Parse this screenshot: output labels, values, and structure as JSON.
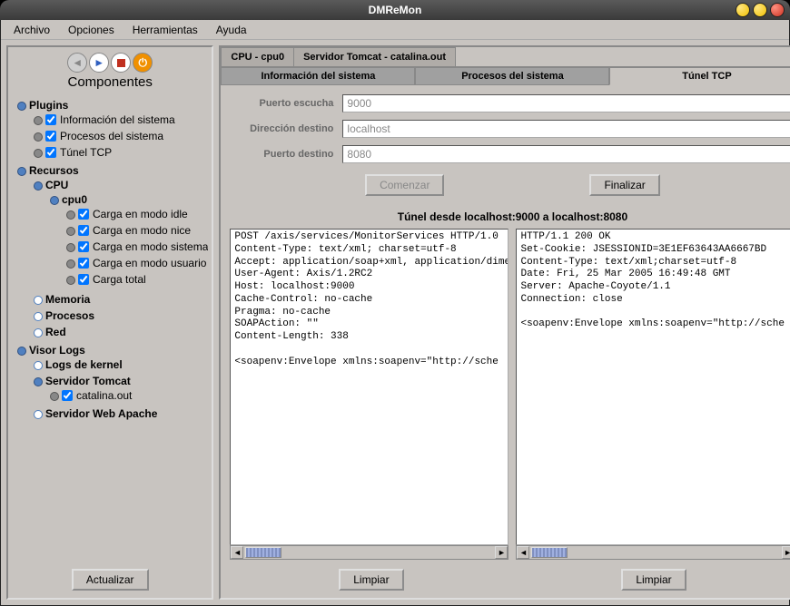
{
  "window": {
    "title": "DMReMon"
  },
  "menu": {
    "items": [
      "Archivo",
      "Opciones",
      "Herramientas",
      "Ayuda"
    ]
  },
  "sidebar": {
    "title": "Componentes",
    "update_btn": "Actualizar",
    "plugins": {
      "label": "Plugins",
      "items": [
        "Información del sistema",
        "Procesos del sistema",
        "Túnel TCP"
      ]
    },
    "recursos": {
      "label": "Recursos",
      "cpu": {
        "label": "CPU",
        "cpu0": {
          "label": "cpu0",
          "items": [
            "Carga en modo idle",
            "Carga en modo nice",
            "Carga en modo sistema",
            "Carga en modo usuario",
            "Carga total"
          ]
        }
      },
      "memoria": "Memoria",
      "procesos": "Procesos",
      "red": "Red"
    },
    "visorlogs": {
      "label": "Visor Logs",
      "kernel": "Logs de kernel",
      "tomcat": {
        "label": "Servidor Tomcat",
        "items": [
          "catalina.out"
        ]
      },
      "apache": "Servidor Web Apache"
    }
  },
  "tabs": {
    "top": [
      "CPU - cpu0",
      "Servidor Tomcat - catalina.out"
    ],
    "sub": [
      "Información del sistema",
      "Procesos del sistema",
      "Túnel TCP"
    ]
  },
  "form": {
    "listen_label": "Puerto escucha",
    "listen_value": "9000",
    "host_label": "Dirección destino",
    "host_value": "localhost",
    "destport_label": "Puerto destino",
    "destport_value": "8080",
    "start_btn": "Comenzar",
    "stop_btn": "Finalizar"
  },
  "tunnel": {
    "title": "Túnel desde localhost:9000 a localhost:8080",
    "request": "POST /axis/services/MonitorServices HTTP/1.0\nContent-Type: text/xml; charset=utf-8\nAccept: application/soap+xml, application/dime\nUser-Agent: Axis/1.2RC2\nHost: localhost:9000\nCache-Control: no-cache\nPragma: no-cache\nSOAPAction: \"\"\nContent-Length: 338\n\n<soapenv:Envelope xmlns:soapenv=\"http://sche",
    "response": "HTTP/1.1 200 OK\nSet-Cookie: JSESSIONID=3E1EF63643AA6667BD\nContent-Type: text/xml;charset=utf-8\nDate: Fri, 25 Mar 2005 16:49:48 GMT\nServer: Apache-Coyote/1.1\nConnection: close\n\n<soapenv:Envelope xmlns:soapenv=\"http://sche",
    "clear_btn": "Limpiar"
  }
}
